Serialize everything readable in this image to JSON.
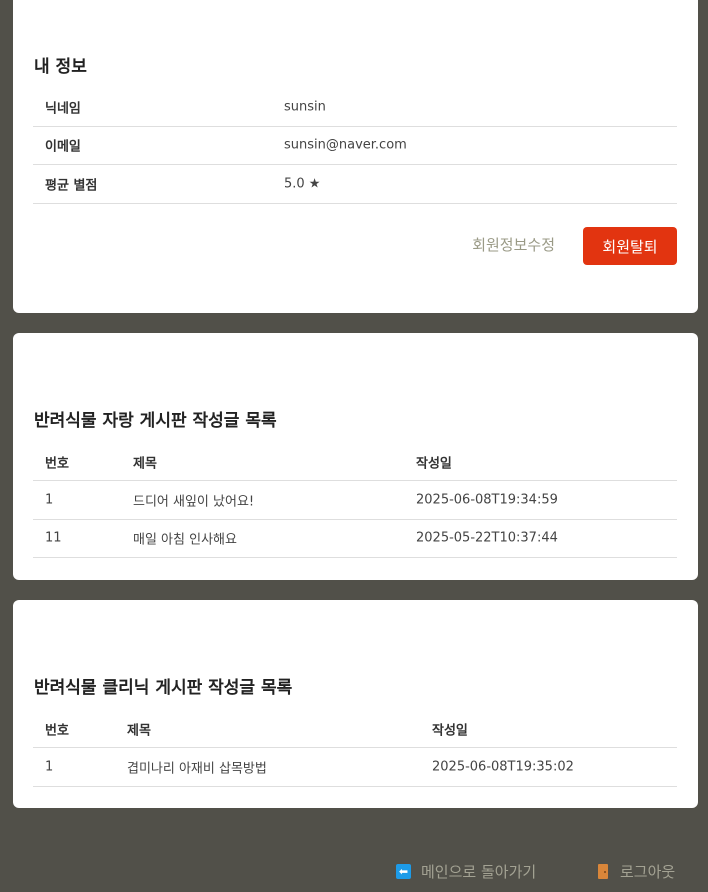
{
  "profile": {
    "title": "내 정보",
    "rows": [
      {
        "label": "닉네임",
        "value": "sunsin"
      },
      {
        "label": "이메일",
        "value": "sunsin@naver.com"
      },
      {
        "label": "평균 별점",
        "value": "5.0 ★"
      }
    ],
    "edit_label": "회원정보수정",
    "withdraw_label": "회원탈퇴"
  },
  "posts": {
    "title": "반려식물 자랑 게시판 작성글 목록",
    "headers": [
      "번호",
      "제목",
      "작성일"
    ],
    "rows": [
      {
        "no": "1",
        "title": "드디어 새잎이 났어요!",
        "date": "2025-06-08T19:34:59"
      },
      {
        "no": "11",
        "title": "매일 아침 인사해요",
        "date": "2025-05-22T10:37:44"
      }
    ]
  },
  "clinic": {
    "title": "반려식물 클리닉 게시판 작성글 목록",
    "headers": [
      "번호",
      "제목",
      "작성일"
    ],
    "rows": [
      {
        "no": "1",
        "title": "겹미나리 아재비 삽목방법",
        "date": "2025-06-08T19:35:02"
      }
    ]
  },
  "footer": {
    "home_label": "메인으로 돌아가기",
    "home_icon": "back-arrow-icon",
    "logout_label": "로그아웃",
    "logout_icon": "door-icon"
  },
  "colors": {
    "background": "#515049",
    "danger": "#e23410",
    "muted_link": "#9a9a86"
  }
}
